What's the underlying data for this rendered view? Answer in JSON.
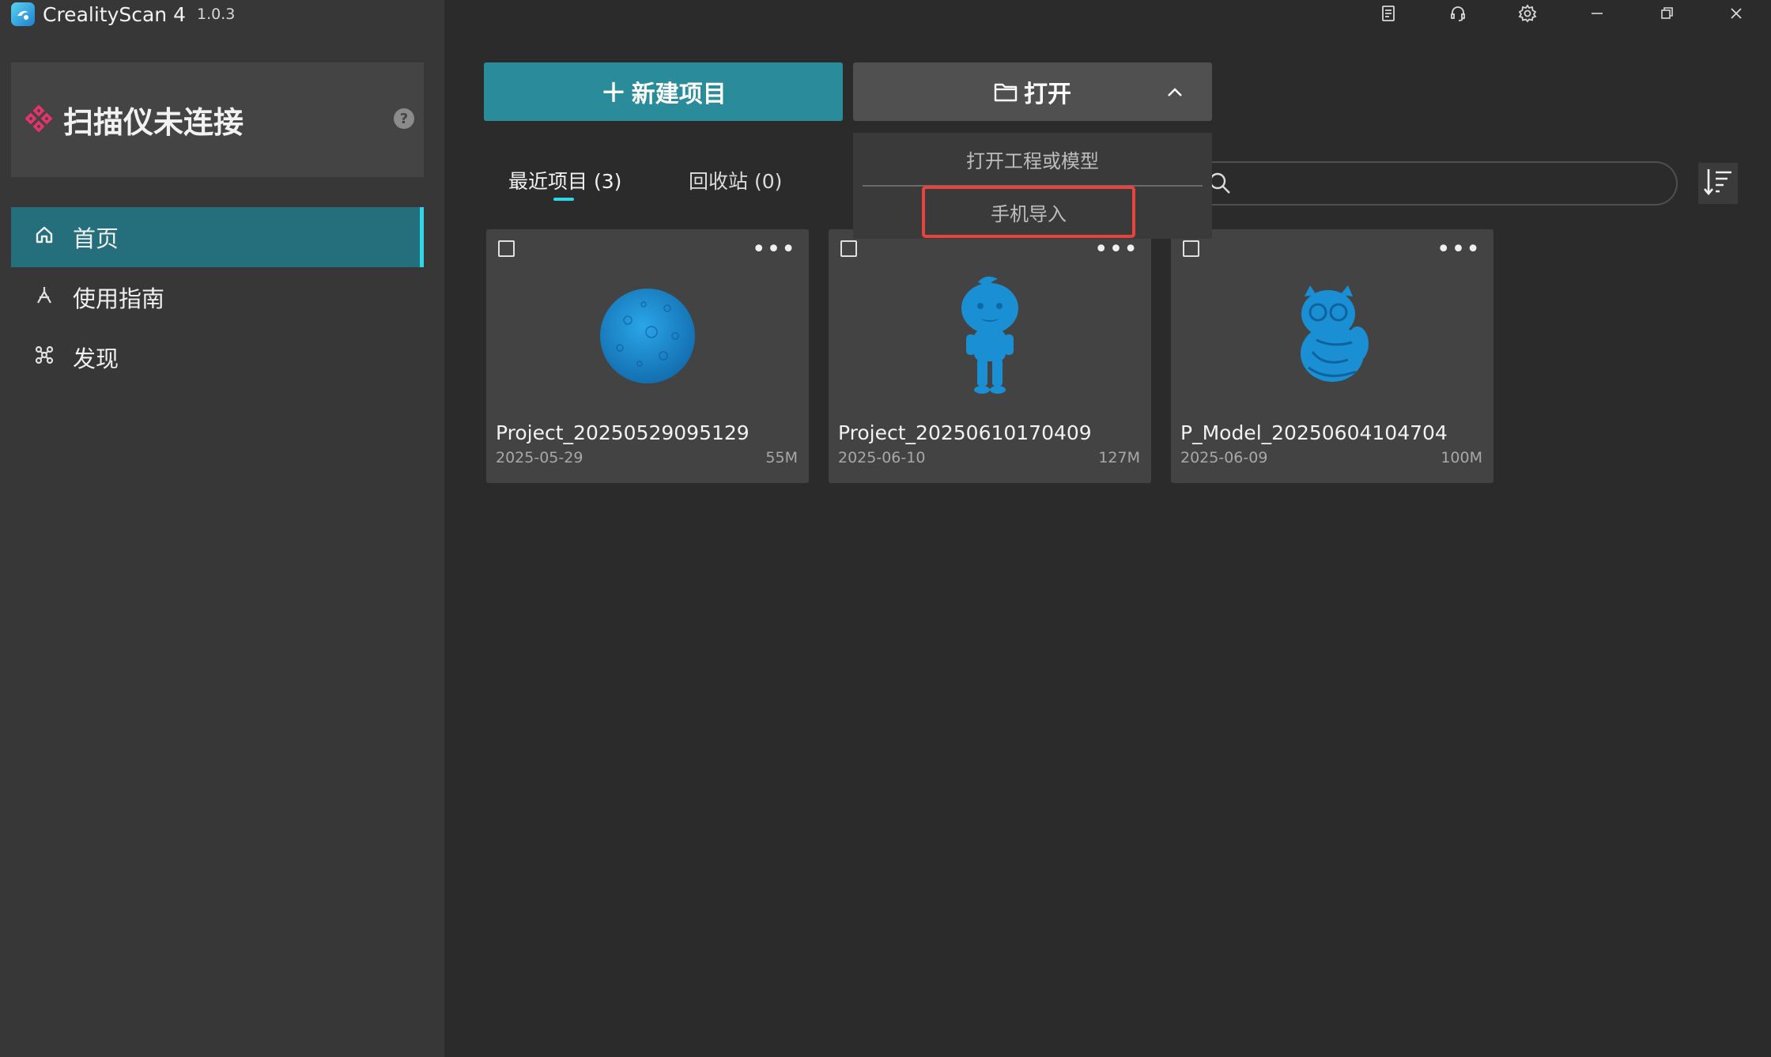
{
  "app": {
    "name": "CrealityScan 4",
    "version": "1.0.3"
  },
  "scanner": {
    "status": "扫描仪未连接",
    "help": "?"
  },
  "sidebar": {
    "items": [
      {
        "label": "首页",
        "icon": "home-icon",
        "active": true
      },
      {
        "label": "使用指南",
        "icon": "guide-icon",
        "active": false
      },
      {
        "label": "发现",
        "icon": "discover-icon",
        "active": false
      }
    ]
  },
  "toolbar": {
    "new_project_plus": "+",
    "new_project_label": "新建项目",
    "open_label": "打开"
  },
  "open_menu": {
    "items": [
      {
        "label": "打开工程或模型"
      },
      {
        "label": "手机导入",
        "highlighted": true
      }
    ]
  },
  "tabs": {
    "recent_label": "最近项目 (3)",
    "trash_label": "回收站 (0)"
  },
  "search": {
    "placeholder": ""
  },
  "more_glyph": "•••",
  "projects": [
    {
      "name": "Project_20250529095129",
      "date": "2025-05-29",
      "size": "55M",
      "thumbnail": "sphere"
    },
    {
      "name": "Project_20250610170409",
      "date": "2025-06-10",
      "size": "127M",
      "thumbnail": "figurine"
    },
    {
      "name": "P_Model_20250604104704",
      "date": "2025-06-09",
      "size": "100M",
      "thumbnail": "owl"
    }
  ],
  "colors": {
    "accent": "#2fd6e8",
    "primary_button": "#2a8b9a",
    "active_nav": "#256f7c",
    "highlight_border": "#e8443f",
    "model_blue": "#1a8fd4"
  }
}
